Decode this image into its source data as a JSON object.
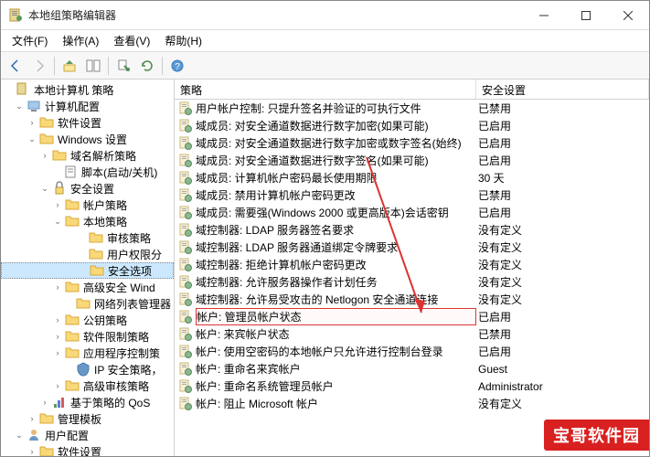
{
  "titlebar": {
    "title": "本地组策略编辑器"
  },
  "menubar": {
    "file": "文件(F)",
    "action": "操作(A)",
    "view": "查看(V)",
    "help": "帮助(H)"
  },
  "tree": {
    "root": "本地计算机 策略",
    "computer_config": "计算机配置",
    "software_settings": "软件设置",
    "windows_settings": "Windows 设置",
    "name_resolution": "域名解析策略",
    "scripts": "脚本(启动/关机)",
    "security_settings": "安全设置",
    "account_policies": "帐户策略",
    "local_policies": "本地策略",
    "audit_policy": "审核策略",
    "user_rights": "用户权限分",
    "security_options": "安全选项",
    "advanced_windows": "高级安全 Wind",
    "network_list": "网络列表管理器",
    "public_key": "公钥策略",
    "software_restriction": "软件限制策略",
    "app_control": "应用程序控制策",
    "ip_security": "IP 安全策略，",
    "advanced_audit": "高级审核策略",
    "qos": "基于策略的 QoS",
    "admin_templates": "管理模板",
    "user_config": "用户配置",
    "software_settings2": "软件设置"
  },
  "list": {
    "header_policy": "策略",
    "header_setting": "安全设置",
    "rows": [
      {
        "policy": "用户帐户控制: 只提升签名并验证的可执行文件",
        "setting": "已禁用"
      },
      {
        "policy": "域成员: 对安全通道数据进行数字加密(如果可能)",
        "setting": "已启用"
      },
      {
        "policy": "域成员: 对安全通道数据进行数字加密或数字签名(始终)",
        "setting": "已启用"
      },
      {
        "policy": "域成员: 对安全通道数据进行数字签名(如果可能)",
        "setting": "已启用"
      },
      {
        "policy": "域成员: 计算机帐户密码最长使用期限",
        "setting": "30 天"
      },
      {
        "policy": "域成员: 禁用计算机帐户密码更改",
        "setting": "已禁用"
      },
      {
        "policy": "域成员: 需要强(Windows 2000 或更高版本)会话密钥",
        "setting": "已启用"
      },
      {
        "policy": "域控制器: LDAP 服务器签名要求",
        "setting": "没有定义"
      },
      {
        "policy": "域控制器: LDAP 服务器通道绑定令牌要求",
        "setting": "没有定义"
      },
      {
        "policy": "域控制器: 拒绝计算机帐户密码更改",
        "setting": "没有定义"
      },
      {
        "policy": "域控制器: 允许服务器操作者计划任务",
        "setting": "没有定义"
      },
      {
        "policy": "域控制器: 允许易受攻击的 Netlogon 安全通道连接",
        "setting": "没有定义"
      },
      {
        "policy": "帐户: 管理员帐户状态",
        "setting": "已启用",
        "highlighted": true
      },
      {
        "policy": "帐户: 来宾帐户状态",
        "setting": "已禁用"
      },
      {
        "policy": "帐户: 使用空密码的本地帐户只允许进行控制台登录",
        "setting": "已启用"
      },
      {
        "policy": "帐户: 重命名来宾帐户",
        "setting": "Guest"
      },
      {
        "policy": "帐户: 重命名系统管理员帐户",
        "setting": "Administrator"
      },
      {
        "policy": "帐户: 阻止 Microsoft 帐户",
        "setting": "没有定义"
      }
    ]
  },
  "watermark": "宝哥软件园"
}
